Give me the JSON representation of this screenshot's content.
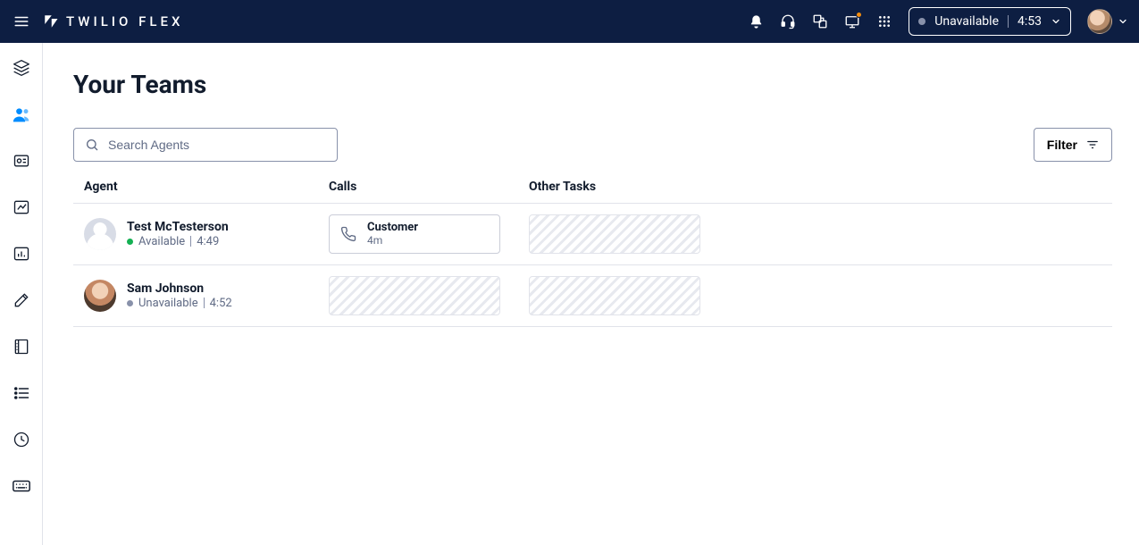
{
  "header": {
    "brand": "TWILIO FLEX",
    "status": {
      "label": "Unavailable",
      "time": "4:53",
      "dot": "grey"
    }
  },
  "page": {
    "title": "Your Teams",
    "search_placeholder": "Search Agents",
    "filter_label": "Filter"
  },
  "columns": {
    "agent": "Agent",
    "calls": "Calls",
    "other": "Other Tasks"
  },
  "agents": [
    {
      "name": "Test McTesterson",
      "status_dot": "green",
      "status_label": "Available",
      "status_time": "4:49",
      "avatar": "default",
      "call": {
        "title": "Customer",
        "duration": "4m"
      },
      "other": null
    },
    {
      "name": "Sam Johnson",
      "status_dot": "grey",
      "status_label": "Unavailable",
      "status_time": "4:52",
      "avatar": "photo",
      "call": null,
      "other": null
    }
  ]
}
